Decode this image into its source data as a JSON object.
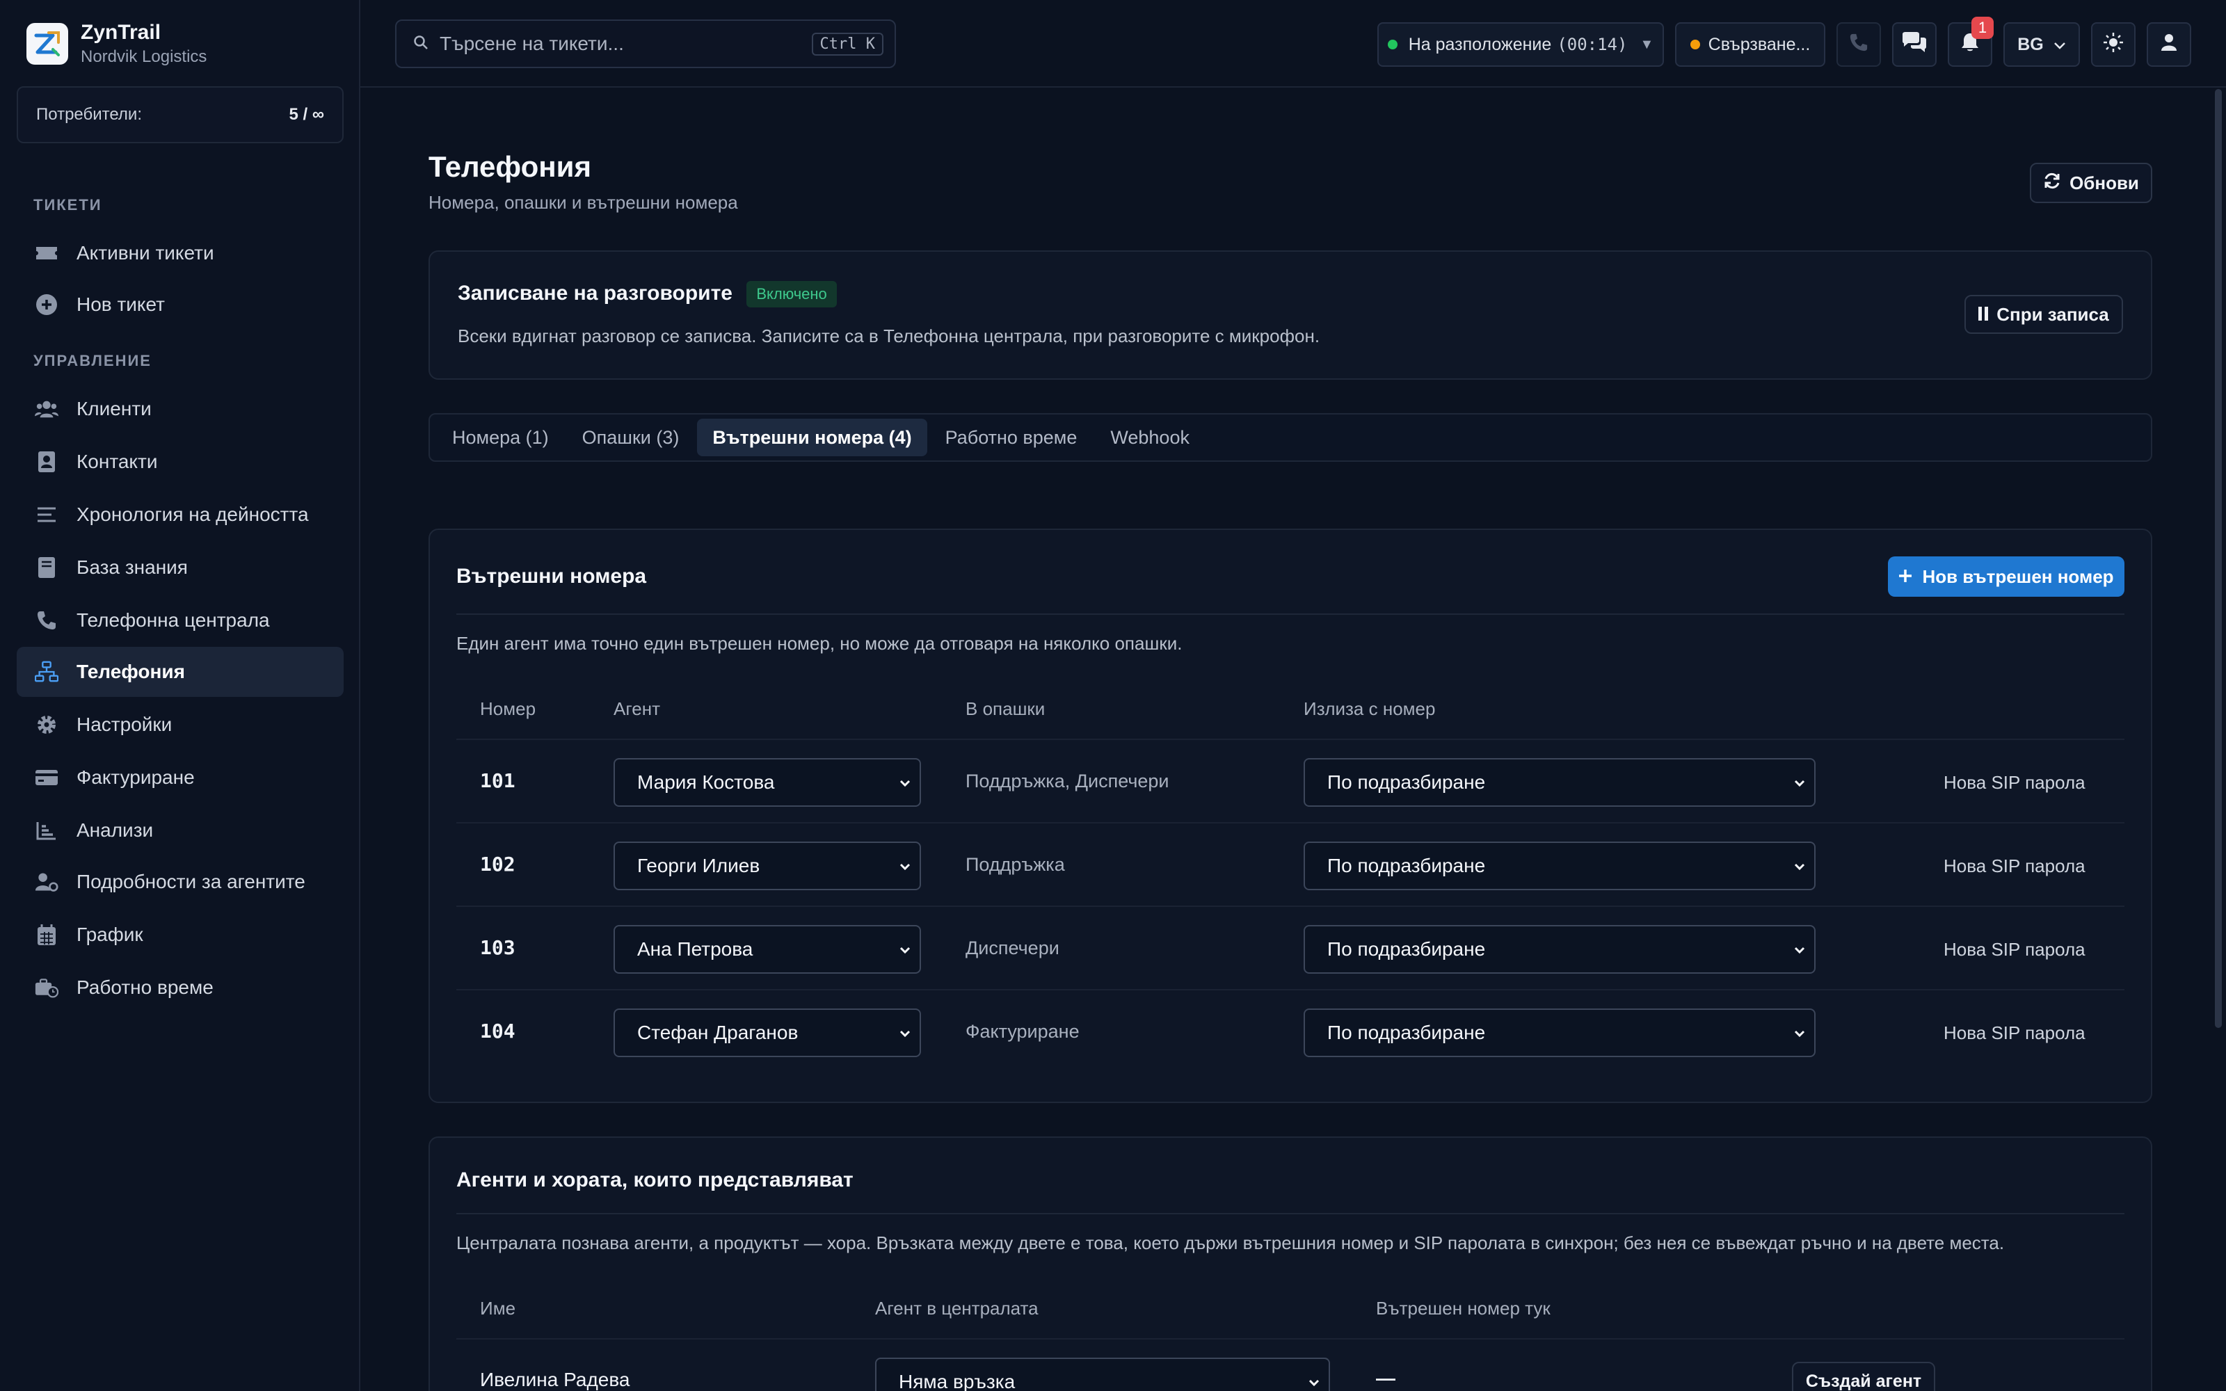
{
  "sidebar": {
    "brand_title": "ZynTrail",
    "brand_sub": "Nordvik Logistics",
    "users_label": "Потребители:",
    "users_value": "5 / ∞",
    "section_tickets": "ТИКЕТИ",
    "section_manage": "УПРАВЛЕНИЕ",
    "items": [
      {
        "label": "Активни тикети",
        "icon": "ticket-icon"
      },
      {
        "label": "Нов тикет",
        "icon": "plus-circle-icon"
      },
      {
        "label": "Клиенти",
        "icon": "users-icon"
      },
      {
        "label": "Контакти",
        "icon": "contact-card-icon"
      },
      {
        "label": "Хронология на дейността",
        "icon": "list-icon"
      },
      {
        "label": "База знания",
        "icon": "book-icon"
      },
      {
        "label": "Телефонна централа",
        "icon": "phone-icon"
      },
      {
        "label": "Телефония",
        "icon": "network-icon"
      },
      {
        "label": "Настройки",
        "icon": "gear-icon"
      },
      {
        "label": "Фактуриране",
        "icon": "credit-card-icon"
      },
      {
        "label": "Анализи",
        "icon": "bar-chart-icon"
      },
      {
        "label": "Подробности за агентите",
        "icon": "user-gear-icon"
      },
      {
        "label": "График",
        "icon": "calendar-icon"
      },
      {
        "label": "Работно време",
        "icon": "business-time-icon"
      }
    ]
  },
  "topbar": {
    "search_placeholder": "Търсене на тикети...",
    "search_shortcut": "Ctrl K",
    "status_label": "На разположение",
    "status_timer": "(00:14)",
    "connection_label": "Свързване...",
    "notification_count": "1",
    "language": "BG"
  },
  "page": {
    "title": "Телефония",
    "subtitle": "Номера, опашки и вътрешни номера",
    "refresh_label": "Обнови"
  },
  "recording": {
    "title": "Записване на разговорите",
    "status": "Включено",
    "description": "Всеки вдигнат разговор се записва. Записите са в Телефонна централа, при разговорите с микрофон.",
    "stop_label": "Спри записа"
  },
  "tabs": [
    "Номера (1)",
    "Опашки (3)",
    "Вътрешни номера (4)",
    "Работно време",
    "Webhook"
  ],
  "extensions": {
    "title": "Вътрешни номера",
    "new_button": "Нов вътрешен номер",
    "description": "Един агент има точно един вътрешен номер, но може да отговаря на няколко опашки.",
    "headers": [
      "Номер",
      "Агент",
      "В опашки",
      "Излиза с номер"
    ],
    "rows": [
      {
        "number": "101",
        "agent": "Мария Костова",
        "queues": "Поддръжка, Диспечери",
        "outbound": "По подразбиране",
        "action": "Нова SIP парола"
      },
      {
        "number": "102",
        "agent": "Георги Илиев",
        "queues": "Поддръжка",
        "outbound": "По подразбиране",
        "action": "Нова SIP парола"
      },
      {
        "number": "103",
        "agent": "Ана Петрова",
        "queues": "Диспечери",
        "outbound": "По подразбиране",
        "action": "Нова SIP парола"
      },
      {
        "number": "104",
        "agent": "Стефан Драганов",
        "queues": "Фактуриране",
        "outbound": "По подразбиране",
        "action": "Нова SIP парола"
      }
    ]
  },
  "agents": {
    "title": "Агенти и хората, които представляват",
    "description": "Централата познава агенти, а продуктът — хора. Връзката между двете е това, което държи вътрешния номер и SIP паролата в синхрон; без нея се въвеждат ръчно и на двете места.",
    "headers": [
      "Име",
      "Агент в централата",
      "Вътрешен номер тук"
    ],
    "rows": [
      {
        "name": "Ивелина Радева",
        "agent": "Няма връзка",
        "extension": "—",
        "action": "Създай агент"
      }
    ]
  },
  "colors": {
    "accent": "#1f78d1",
    "active_nav": "#1b2538",
    "status_green": "#22c55e",
    "status_orange": "#f59e0b",
    "badge_red": "#e5484d"
  }
}
